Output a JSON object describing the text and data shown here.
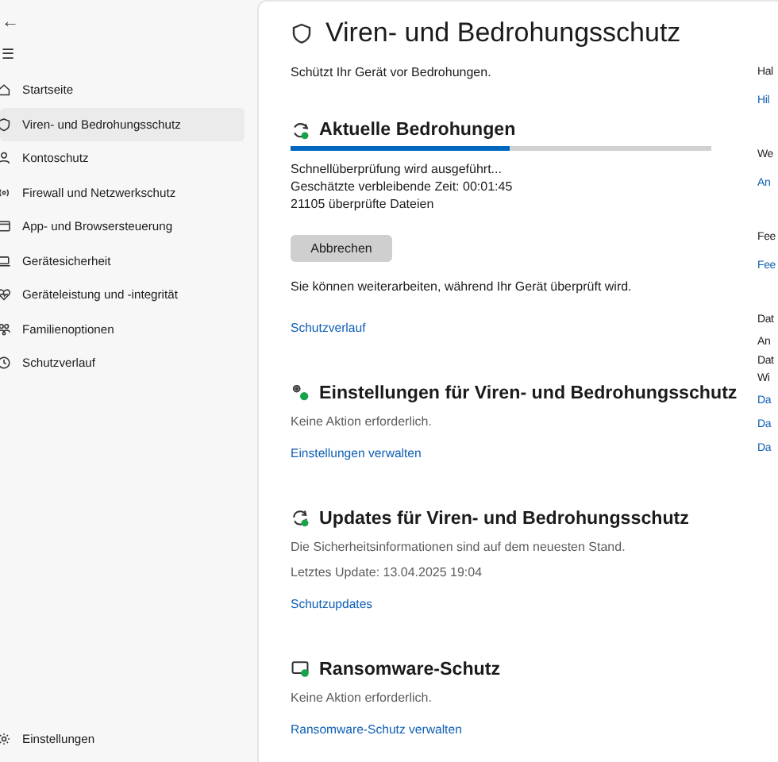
{
  "sidebar": {
    "back": "←",
    "menu": "☰",
    "items": [
      {
        "label": "Startseite",
        "selected": false
      },
      {
        "label": "Viren- und Bedrohungsschutz",
        "selected": true
      },
      {
        "label": "Kontoschutz",
        "selected": false
      },
      {
        "label": "Firewall und Netzwerkschutz",
        "selected": false
      },
      {
        "label": "App- und Browsersteuerung",
        "selected": false
      },
      {
        "label": "Gerätesicherheit",
        "selected": false
      },
      {
        "label": "Geräteleistung und -integrität",
        "selected": false
      },
      {
        "label": "Familienoptionen",
        "selected": false
      },
      {
        "label": "Schutzverlauf",
        "selected": false
      }
    ],
    "settings": "Einstellungen"
  },
  "page": {
    "title": "Viren- und Bedrohungsschutz",
    "subtitle": "Schützt Ihr Gerät vor Bedrohungen."
  },
  "sections": [
    {
      "kind": "scan",
      "title": "Aktuelle Bedrohungen",
      "level": 0.52,
      "lines": [
        "Schnellüberprüfung wird ausgeführt...",
        "Geschätzte verbleibende Zeit: 00:01:45",
        "21105 überprüfte Dateien"
      ],
      "button": "Abbrechen",
      "note": "Sie können weiterarbeiten, während Ihr Gerät überprüft wird.",
      "link": "Schutzverlauf"
    },
    {
      "kind": "status",
      "title": "Einstellungen für Viren- und Bedrohungsschutz",
      "lines": [
        "Keine Aktion erforderlich."
      ],
      "link": "Einstellungen verwalten"
    },
    {
      "kind": "status",
      "title": "Updates für Viren- und Bedrohungsschutz",
      "lines": [
        "Die Sicherheitsinformationen sind auf dem neuesten Stand.",
        "Letztes Update: 13.04.2025 19:04"
      ],
      "link": "Schutzupdates"
    },
    {
      "kind": "status",
      "title": "Ransomware-Schutz",
      "lines": [
        "Keine Aktion erforderlich."
      ],
      "link": "Ransomware-Schutz verwalten"
    }
  ],
  "side_panel": [
    {
      "heading": "Hal",
      "links": [
        "Hil"
      ]
    },
    {
      "heading": "We",
      "links": [
        "An"
      ]
    },
    {
      "heading": "Fee",
      "links": [
        "Fee"
      ]
    },
    {
      "heading": "Dat",
      "lines": [
        "An",
        "Dat",
        "Wi"
      ],
      "links": [
        "Da",
        "Da",
        "Da"
      ]
    }
  ]
}
